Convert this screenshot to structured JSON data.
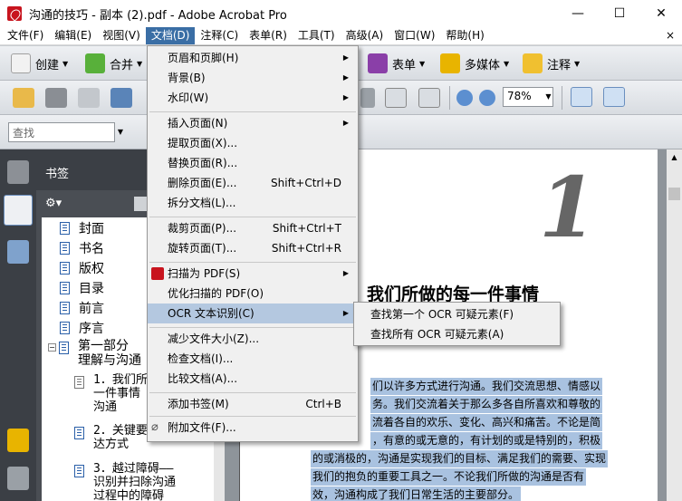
{
  "window": {
    "title": "沟通的技巧 - 副本 (2).pdf - Adobe Acrobat Pro",
    "minimize": "—",
    "maximize": "☐",
    "close": "✕"
  },
  "menubar": {
    "items": [
      "文件(F)",
      "编辑(E)",
      "视图(V)",
      "文档(D)",
      "注释(C)",
      "表单(R)",
      "工具(T)",
      "高级(A)",
      "窗口(W)",
      "帮助(H)"
    ],
    "close": "×"
  },
  "toolbar1": {
    "create": "创建",
    "combine": "合并",
    "forms": "表单",
    "multimedia": "多媒体",
    "comment": "注释"
  },
  "toolbar2": {
    "zoom_value": "78%"
  },
  "toolbar3": {
    "search_placeholder": "查找"
  },
  "bookmarks": {
    "header": "书签",
    "items": [
      "封面",
      "书名",
      "版权",
      "目录",
      "前言",
      "序言"
    ],
    "part1_line1": "第一部分",
    "part1_line2": "理解与沟通",
    "sub1": [
      "1．我们所",
      "一件事情",
      "沟通"
    ],
    "sub2": [
      "2．关键要",
      "达方式"
    ],
    "sub3": [
      "3．越过障碍——",
      "识别并扫除沟通",
      "过程中的障碍"
    ]
  },
  "document": {
    "big_numeral": "1",
    "chapter_title": "我们所做的每一件事情",
    "para_lines": [
      "们以许多方式进行沟通。我们交流思想、情感以",
      "务。我们交流着关于那么多各自所喜欢和尊敬的",
      "流着各自的欢乐、变化、高兴和痛苦。不论是简",
      "，有意的或无意的，有计划的或是特别的，积极",
      "的或消极的，沟通是实现我们的目标、满足我们的需要、实现",
      "我们的抱负的重要工具之一。不论我们所做的沟通是否有",
      "效，沟通构成了我们日常生活的主要部分。"
    ]
  },
  "doc_menu": {
    "items": [
      {
        "label": "页眉和页脚(H)",
        "shortcut": "",
        "submenu": true
      },
      {
        "label": "背景(B)",
        "shortcut": "",
        "submenu": true
      },
      {
        "label": "水印(W)",
        "shortcut": "",
        "submenu": true
      },
      {
        "label": "插入页面(N)",
        "shortcut": "",
        "submenu": true
      },
      {
        "label": "提取页面(X)...",
        "shortcut": "",
        "submenu": false
      },
      {
        "label": "替换页面(R)...",
        "shortcut": "",
        "submenu": false
      },
      {
        "label": "删除页面(E)...",
        "shortcut": "Shift+Ctrl+D",
        "submenu": false
      },
      {
        "label": "拆分文档(L)...",
        "shortcut": "",
        "submenu": false
      },
      {
        "label": "裁剪页面(P)...",
        "shortcut": "Shift+Ctrl+T",
        "submenu": false
      },
      {
        "label": "旋转页面(T)...",
        "shortcut": "Shift+Ctrl+R",
        "submenu": false
      },
      {
        "label": "扫描为 PDF(S)",
        "shortcut": "",
        "submenu": true
      },
      {
        "label": "优化扫描的 PDF(O)",
        "shortcut": "",
        "submenu": false
      },
      {
        "label": "OCR 文本识别(C)",
        "shortcut": "",
        "submenu": true
      },
      {
        "label": "减少文件大小(Z)...",
        "shortcut": "",
        "submenu": false
      },
      {
        "label": "检查文档(I)...",
        "shortcut": "",
        "submenu": false
      },
      {
        "label": "比较文档(A)...",
        "shortcut": "",
        "submenu": false
      },
      {
        "label": "添加书签(M)",
        "shortcut": "Ctrl+B",
        "submenu": false
      },
      {
        "label": "附加文件(F)...",
        "shortcut": "",
        "submenu": false
      }
    ]
  },
  "ocr_submenu": {
    "items": [
      "查找第一个 OCR 可疑元素(F)",
      "查找所有 OCR 可疑元素(A)"
    ]
  },
  "colors": {
    "menu_active": "#3a6ea5",
    "highlight": "#b4c8e0",
    "selection": "#a9c2e0",
    "dark_panel": "#3b3f45"
  }
}
